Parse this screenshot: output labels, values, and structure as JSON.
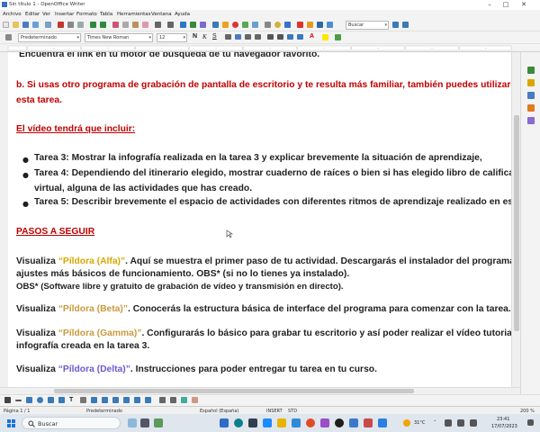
{
  "window": {
    "title": "Sin título 1 - OpenOffice Writer"
  },
  "menu": [
    "Archivo",
    "Editar",
    "Ver",
    "Insertar",
    "Formato",
    "Tabla",
    "Herramientas",
    "Ventana",
    "Ayuda"
  ],
  "toolbar": {
    "search_placeholder": "Buscar",
    "style_value": "Predeterminado",
    "font_value": "Times New Roman",
    "size_value": "12"
  },
  "document": {
    "line_top": "Encuentra el link en tu motor de búsqueda de tu navegador favorito.",
    "b_line1": "b. Si usas otro programa de grabación de pantalla de escritorio y te resulta más familiar, también puedes utilizarlo",
    "b_line2": "esta tarea.",
    "video_heading": "El vídeo tendrá que incluir:",
    "bullets": [
      "Tarea 3: Mostrar la infografía realizada en la tarea 3 y explicar brevemente la situación de aprendizaje,",
      "Tarea 4: Dependiendo del itinerario elegido, mostrar cuaderno de raíces o bien si has elegido libro de calificació",
      "virtual, alguna de las actividades que has creado.",
      "Tarea 5: Describir brevemente el espacio de actividades con diferentes ritmos de aprendizaje realizado en esta"
    ],
    "steps_heading": "PASOS A SEGUIR",
    "visualiza": "Visualiza ",
    "alfa_link": "“Píldora (Alfa)”",
    "alfa_rest": ". Aquí se muestra el primer paso de tu actividad. Descargarás el instalador del programa y",
    "alfa_line2": "ajustes más básicos de funcionamiento. OBS* (si no lo tienes ya instalado).",
    "obs_note": "OBS* (Software libre y gratuito de grabación de vídeo y transmisión en directo).",
    "beta_link": "“Píldora (Beta)”",
    "beta_rest": ". Conocerás la estructura básica de interface del programa para comenzar con la tarea.",
    "gamma_link": "“Píldora (Gamma)”",
    "gamma_rest": ". Configurarás lo básico para grabar tu escritorio y así poder realizar el vídeo tutorial e",
    "gamma_line2": "infografía creada en la tarea 3.",
    "delta_link": "“Píldora (Delta)”",
    "delta_rest": ". Instrucciones para poder entregar tu tarea en tu curso."
  },
  "statusbar": {
    "page": "Página 1 / 1",
    "style": "Predeterminado",
    "language": "Español (España)",
    "insert": "INSERT",
    "std": "STD",
    "zoom": "200 %"
  },
  "taskbar": {
    "search_label": "Buscar",
    "temperature": "31°C",
    "time": "23:41",
    "date": "17/07/2023"
  },
  "colors": {
    "red_text": "#c00000",
    "alfa": "#d9a700",
    "beta": "#c99a3e",
    "gamma": "#c99a3e",
    "delta": "#6c59d1"
  }
}
